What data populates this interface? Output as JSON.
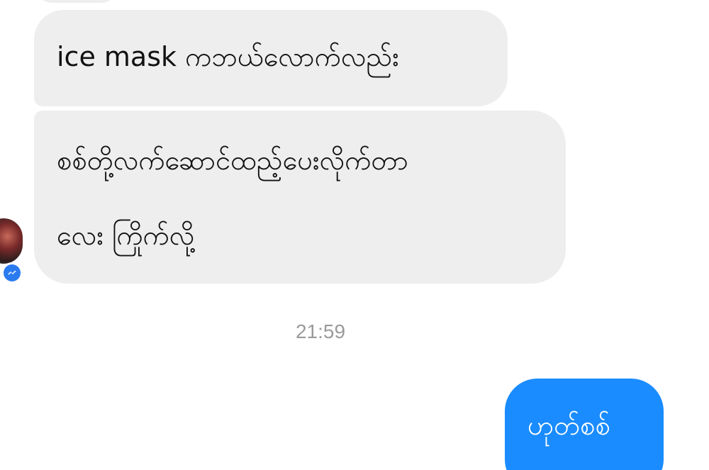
{
  "messages": {
    "incoming": [
      {
        "text": "ice mask ကဘယ်လောက်လည်း"
      },
      {
        "lines": [
          "စစ်တို့လက်ဆောင်ထည့်ပေးလိုက်တာ",
          "လေး ကြိုက်လို့"
        ]
      }
    ],
    "timestamp": "21:59",
    "outgoing": [
      {
        "text": "ဟုတ်စစ်"
      }
    ]
  },
  "colors": {
    "incoming_bubble": "#eeeeee",
    "outgoing_bubble": "#1a8cff",
    "messenger_badge": "#2b7bf0",
    "timestamp_text": "#9a9a9a"
  },
  "icons": {
    "badge": "messenger-icon"
  }
}
